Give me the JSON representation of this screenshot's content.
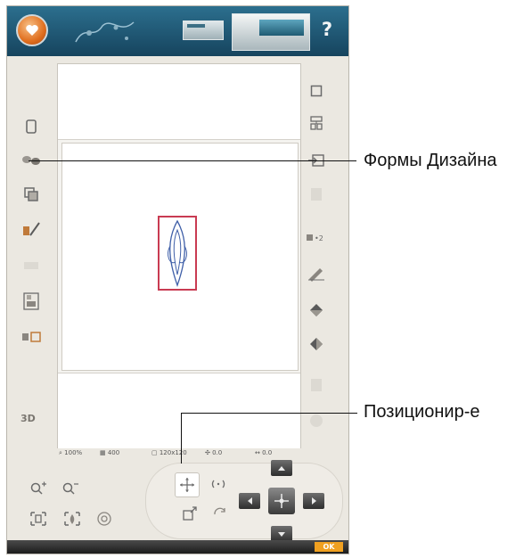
{
  "annotations": {
    "design_shapes": "Формы Дизайна",
    "positioning": "Позиционир-е"
  },
  "topbar": {
    "help_label": "?"
  },
  "status": {
    "zoom": "100%",
    "stitches": "400",
    "hoop_size": "120x120",
    "position": "0.0",
    "rotation": "0.0"
  },
  "icons": {
    "left": [
      "layout-icon",
      "design-shapes-icon",
      "duplicate-icon",
      "edit-stitches-icon",
      "disabled-icon",
      "stitch-density-icon",
      "hoop-convert-icon",
      "view-3d-icon"
    ],
    "right": [
      "select-box-icon",
      "group-icon",
      "insert-icon",
      "disabled-icon",
      "stitch-x2-icon",
      "edit-pen-icon",
      "arrange-up-icon",
      "arrange-down-icon",
      "disabled-icon",
      "disabled-icon"
    ]
  },
  "colors": {
    "topbar": "#1f5a76",
    "design_frame": "#c93b52",
    "design_stitch": "#3f5fa8",
    "ok_badge": "#f0a020"
  },
  "bottombar": {
    "ok": "OK"
  }
}
